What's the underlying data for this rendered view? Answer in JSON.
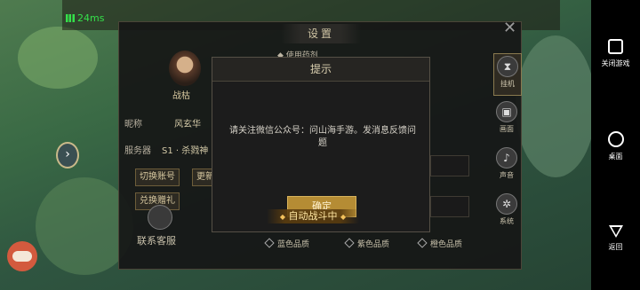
{
  "status": {
    "ping": "24ms"
  },
  "settings": {
    "title": "设置",
    "use_potion": "使用药剂",
    "avatar_label": "战枯",
    "nickname_label": "昵称",
    "nickname_value": "风玄华",
    "server_label": "服务器",
    "server_value": "S1 · 杀戮神",
    "switch_account": "切换账号",
    "more_btn": "更新",
    "redeem_gift": "兑换赠礼",
    "contact_service": "联系客服",
    "tabs": [
      {
        "label": "挂机",
        "icon": "hourglass-icon"
      },
      {
        "label": "画面",
        "icon": "picture-icon"
      },
      {
        "label": "声音",
        "icon": "speaker-icon"
      },
      {
        "label": "系统",
        "icon": "gear-icon"
      }
    ],
    "quality": [
      "蓝色品质",
      "紫色品质",
      "橙色品质"
    ]
  },
  "dialog": {
    "title": "提示",
    "message": "请关注微信公众号：问山海手游。发消息反馈问题",
    "confirm": "确定"
  },
  "auto_battle": "自动战斗中",
  "navbar": {
    "close_game": "关闭游戏",
    "home": "桌面",
    "back": "返回"
  },
  "colors": {
    "accent_gold": "#b58c34",
    "ping_green": "#35e04a",
    "fab_red": "#d35a3e"
  }
}
